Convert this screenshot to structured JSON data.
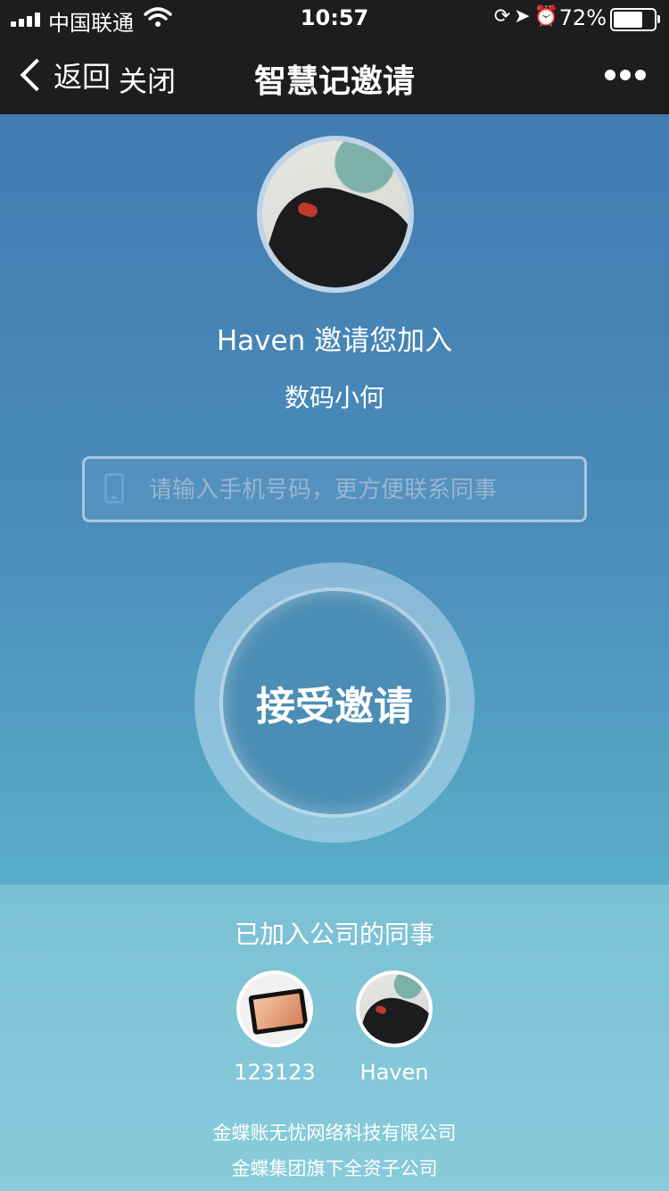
{
  "status_bar": {
    "carrier": "中国联通",
    "time": "10:57",
    "battery_percent": "72%",
    "battery_level": 0.72,
    "icons": [
      "signal-icon",
      "wifi-icon",
      "rotation-lock-icon",
      "location-icon",
      "alarm-icon",
      "battery-icon"
    ]
  },
  "nav": {
    "back_label": "返回",
    "close_label": "关闭",
    "title": "智慧记邀请",
    "more_icon": "more-dots-icon"
  },
  "invite": {
    "inviter_text": "Haven 邀请您加入",
    "company_name": "数码小何",
    "phone_placeholder": "请输入手机号码，更方便联系同事",
    "phone_value": "",
    "accept_label": "接受邀请"
  },
  "joined": {
    "title": "已加入公司的同事",
    "members": [
      {
        "name": "123123"
      },
      {
        "name": "Haven"
      }
    ]
  },
  "footer": {
    "line1": "金蝶账无忧网络科技有限公司",
    "line2": "金蝶集团旗下全资子公司"
  }
}
